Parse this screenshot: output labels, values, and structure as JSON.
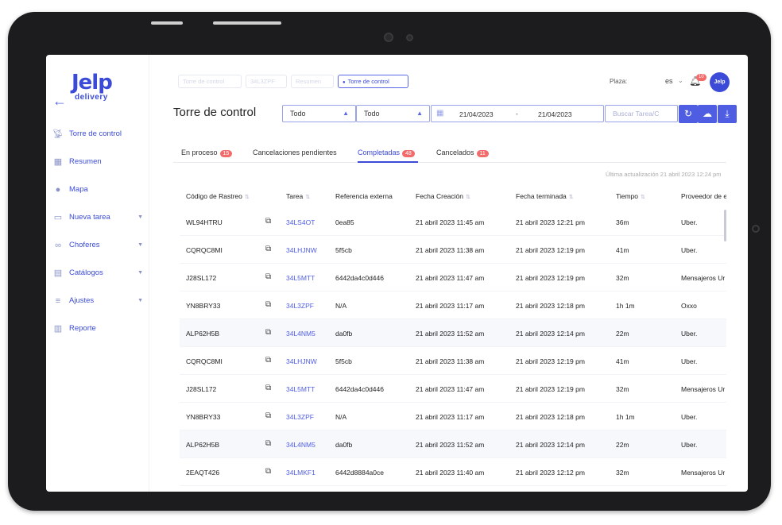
{
  "brand": {
    "name": "Jelp",
    "sub": "delivery"
  },
  "breadcrumbs": [
    "Torre de control",
    "34L3ZPF",
    "Resumen",
    "Torre de control"
  ],
  "topbar": {
    "plaza_label": "Plaza:",
    "language": "es",
    "notif_count": "10",
    "avatar_text": "Jelp"
  },
  "sidebar": {
    "items": [
      {
        "label": "Torre de control",
        "icon": "tower-icon"
      },
      {
        "label": "Resumen",
        "icon": "grid-icon"
      },
      {
        "label": "Mapa",
        "icon": "pin-icon"
      },
      {
        "label": "Nueva tarea",
        "icon": "document-icon"
      },
      {
        "label": "Choferes",
        "icon": "bike-icon"
      },
      {
        "label": "Catálogos",
        "icon": "catalog-icon"
      },
      {
        "label": "Ajustes",
        "icon": "sliders-icon"
      },
      {
        "label": "Reporte",
        "icon": "chart-icon"
      }
    ]
  },
  "page_title": "Torre de control",
  "filters": {
    "select1": "Todo",
    "select2": "Todo",
    "date_from": "21/04/2023",
    "date_sep": "-",
    "date_to": "21/04/2023",
    "search_placeholder": "Buscar Tarea/C"
  },
  "tabs": [
    {
      "label": "En proceso",
      "count": "15"
    },
    {
      "label": "Cancelaciones pendientes",
      "count": ""
    },
    {
      "label": "Completadas",
      "count": "48"
    },
    {
      "label": "Cancelados",
      "count": "11"
    }
  ],
  "last_update": "Última actualización 21 abril 2023 12:24 pm",
  "table": {
    "headers": [
      "Código de Rastreo",
      "Tarea",
      "Referencia externa",
      "Fecha Creación",
      "Fecha terminada",
      "Tiempo",
      "Proveedor de e"
    ],
    "rows": [
      [
        "WL94HTRU",
        "34LS4OT",
        "0ea85",
        "21 abril 2023 11:45 am",
        "21 abril 2023 12:21 pm",
        "36m",
        "Uber."
      ],
      [
        "CQRQC8MI",
        "34LHJNW",
        "5f5cb",
        "21 abril 2023 11:38 am",
        "21 abril 2023 12:19 pm",
        "41m",
        "Uber."
      ],
      [
        "J28SL172",
        "34L5MTT",
        "6442da4c0d446",
        "21 abril 2023 11:47 am",
        "21 abril 2023 12:19 pm",
        "32m",
        "Mensajeros Ur"
      ],
      [
        "YN8BRY33",
        "34L3ZPF",
        "N/A",
        "21 abril 2023 11:17 am",
        "21 abril 2023 12:18 pm",
        "1h 1m",
        "Oxxo"
      ],
      [
        "ALP62H5B",
        "34L4NM5",
        "da0fb",
        "21 abril 2023 11:52 am",
        "21 abril 2023 12:14 pm",
        "22m",
        "Uber."
      ],
      [
        "CQRQC8MI",
        "34LHJNW",
        "5f5cb",
        "21 abril 2023 11:38 am",
        "21 abril 2023 12:19 pm",
        "41m",
        "Uber."
      ],
      [
        "J28SL172",
        "34L5MTT",
        "6442da4c0d446",
        "21 abril 2023 11:47 am",
        "21 abril 2023 12:19 pm",
        "32m",
        "Mensajeros Ur"
      ],
      [
        "YN8BRY33",
        "34L3ZPF",
        "N/A",
        "21 abril 2023 11:17 am",
        "21 abril 2023 12:18 pm",
        "1h 1m",
        "Uber."
      ],
      [
        "ALP62H5B",
        "34L4NM5",
        "da0fb",
        "21 abril 2023 11:52 am",
        "21 abril 2023 12:14 pm",
        "22m",
        "Uber."
      ],
      [
        "2EAQT426",
        "34LMKF1",
        "6442d8884a0ce",
        "21 abril 2023 11:40 am",
        "21 abril 2023 12:12 pm",
        "32m",
        "Mensajeros Ur"
      ]
    ]
  },
  "colors": {
    "accent": "#3b4bd8",
    "badge": "#f26b6b",
    "device": "#1c1c1e"
  }
}
